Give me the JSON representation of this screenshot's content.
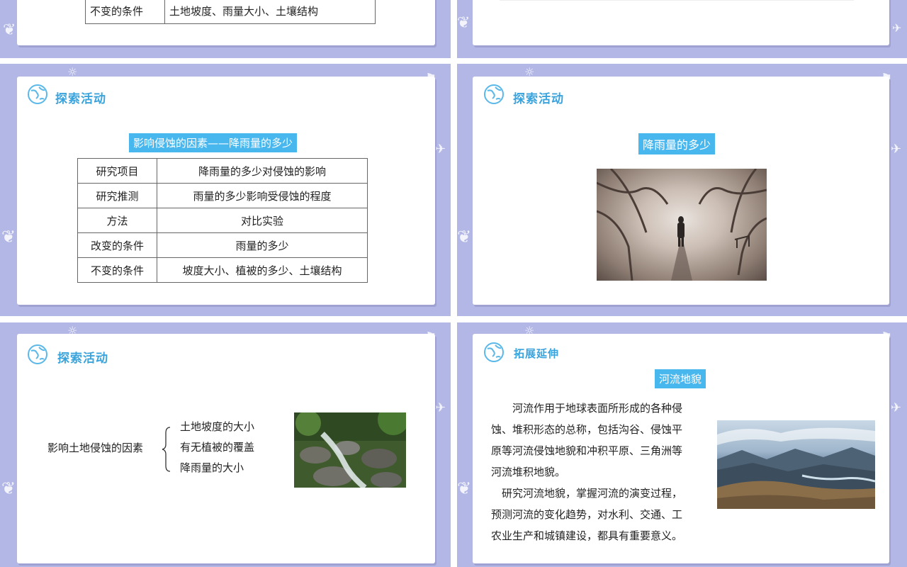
{
  "slide1": {
    "table_row_label": "不变的条件",
    "table_row_value": "土地坡度、雨量大小、土壤结构"
  },
  "slide3": {
    "section_title": "探索活动",
    "banner": "影响侵蚀的因素——降雨量的多少",
    "rows": [
      {
        "label": "研究项目",
        "value": "降雨量的多少对侵蚀的影响"
      },
      {
        "label": "研究推测",
        "value": "雨量的多少影响受侵蚀的程度"
      },
      {
        "label": "方法",
        "value": "对比实验"
      },
      {
        "label": "改变的条件",
        "value": "雨量的多少"
      },
      {
        "label": "不变的条件",
        "value": "坡度大小、植被的多少、土壤结构"
      }
    ]
  },
  "slide4": {
    "section_title": "探索活动",
    "banner": "降雨量的多少"
  },
  "slide5": {
    "section_title": "探索活动",
    "root": "影响土地侵蚀的因素",
    "branches": [
      "土地坡度的大小",
      "有无植被的覆盖",
      "降雨量的大小"
    ]
  },
  "slide6": {
    "section_title": "拓展延伸",
    "banner": "河流地貌",
    "lines": [
      "　　河流作用于地球表面所形成的各种侵",
      "蚀、堆积形态的总称，包括沟谷、侵蚀平",
      "原等河流侵蚀地貌和冲积平原、三角洲等",
      "河流堆积地貌。",
      "　研究河流地貌，掌握河流的演变过程，",
      "预测河流的变化趋势，对水利、交通、工",
      "农业生产和城镇建设，都具有重要意义。"
    ]
  },
  "colors": {
    "frame": "#b3b7e6",
    "title": "#3aa3dc",
    "banner": "#48b7ee"
  },
  "icons": {
    "section": "globe-icon"
  }
}
